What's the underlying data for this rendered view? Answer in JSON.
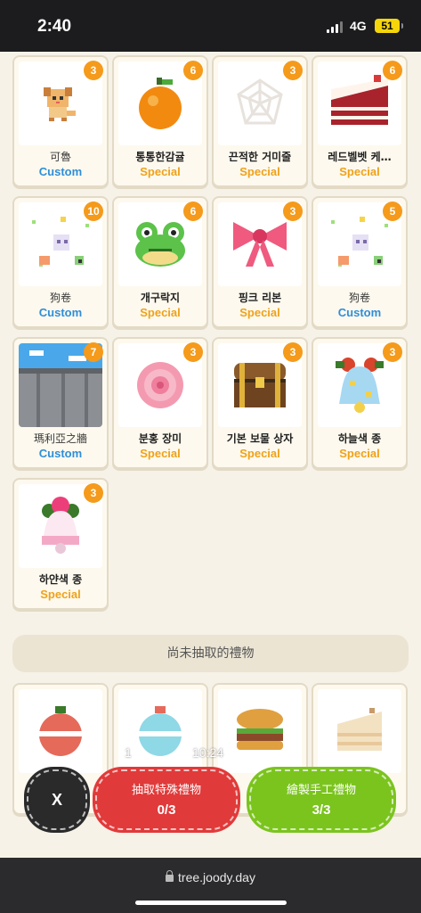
{
  "status": {
    "time": "2:40",
    "network": "4G",
    "battery": "51"
  },
  "gifts": [
    {
      "count": "3",
      "name": "可魯",
      "type": "Custom",
      "icon": "puppy-icon",
      "bold": false
    },
    {
      "count": "6",
      "name": "통통한감귤",
      "type": "Special",
      "icon": "orange-icon",
      "bold": true
    },
    {
      "count": "3",
      "name": "끈적한 거미줄",
      "type": "Special",
      "icon": "spiderweb-icon",
      "bold": true
    },
    {
      "count": "6",
      "name": "레드벨벳 케…",
      "type": "Special",
      "icon": "red-velvet-cake-icon",
      "bold": true
    },
    {
      "count": "10",
      "name": "狗卷",
      "type": "Custom",
      "icon": "custom-sprite-icon",
      "bold": false
    },
    {
      "count": "6",
      "name": "개구락지",
      "type": "Special",
      "icon": "frog-icon",
      "bold": true
    },
    {
      "count": "3",
      "name": "핑크 리본",
      "type": "Special",
      "icon": "pink-ribbon-icon",
      "bold": true
    },
    {
      "count": "5",
      "name": "狗卷",
      "type": "Custom",
      "icon": "custom-sprite-icon",
      "bold": false
    },
    {
      "count": "7",
      "name": "瑪利亞之牆",
      "type": "Custom",
      "icon": "wall-icon",
      "bold": false
    },
    {
      "count": "3",
      "name": "분홍 장미",
      "type": "Special",
      "icon": "pink-rose-icon",
      "bold": true
    },
    {
      "count": "3",
      "name": "기본 보물 상자",
      "type": "Special",
      "icon": "treasure-chest-icon",
      "bold": true
    },
    {
      "count": "3",
      "name": "하늘색 종",
      "type": "Special",
      "icon": "sky-bell-icon",
      "bold": true
    },
    {
      "count": "3",
      "name": "하얀색 종",
      "type": "Special",
      "icon": "white-bell-icon",
      "bold": true
    }
  ],
  "section_title": "尚未抽取的禮物",
  "locked_gifts": [
    {
      "icon": "red-ornament-icon"
    },
    {
      "icon": "blue-ornament-icon"
    },
    {
      "icon": "burger-icon"
    },
    {
      "icon": "cake-slice-icon"
    }
  ],
  "overlay": {
    "left": "1",
    "right": "10:24"
  },
  "actions": {
    "close_label": "X",
    "special": {
      "label": "抽取特殊禮物",
      "count": "0/3"
    },
    "custom": {
      "label": "繪製手工禮物",
      "count": "3/3"
    }
  },
  "browser": {
    "url": "tree.joody.day"
  },
  "colors": {
    "custom": "#2f8ed8",
    "special": "#efa21a",
    "badge": "#f59a1a",
    "red_button": "#e13a3a",
    "green_button": "#7bc41e"
  }
}
